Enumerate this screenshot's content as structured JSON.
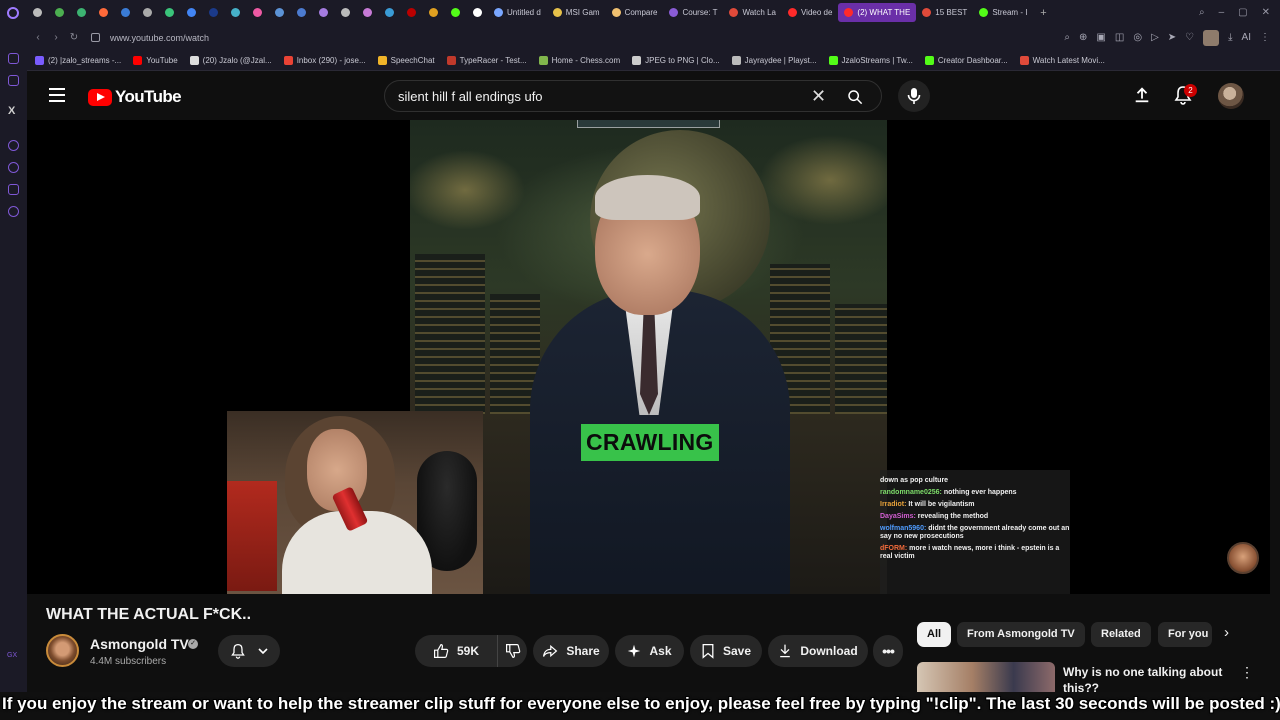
{
  "browser": {
    "tabs": [
      {
        "label": "Untitled d",
        "color": "#7aa7ff"
      },
      {
        "label": "MSI Gam",
        "color": "#e6c14a"
      },
      {
        "label": "Compare",
        "color": "#f0c070"
      },
      {
        "label": "Course: T",
        "color": "#8a5cd6"
      },
      {
        "label": "Watch La",
        "color": "#e04a3a"
      },
      {
        "label": "Video de",
        "color": "#ff2a2a"
      },
      {
        "label": "(2) WHAT THE",
        "color": "#ff2a2a",
        "active": true
      },
      {
        "label": "15 BEST",
        "color": "#e04a3a"
      },
      {
        "label": "Stream - I",
        "color": "#53fc18"
      }
    ],
    "url": "www.youtube.com/watch",
    "ai_label": "AI",
    "bookmarks": [
      {
        "label": "(2) |zalo_streams -...",
        "color": "#7a5cff"
      },
      {
        "label": "YouTube",
        "color": "#ff0000"
      },
      {
        "label": "(20) Jzalo (@Jzal...",
        "color": "#dddddd"
      },
      {
        "label": "Inbox (290) - jose...",
        "color": "#ea4335"
      },
      {
        "label": "SpeechChat",
        "color": "#f0b429"
      },
      {
        "label": "TypeRacer - Test...",
        "color": "#c0392b"
      },
      {
        "label": "Home - Chess.com",
        "color": "#81b64c"
      },
      {
        "label": "JPEG to PNG | Clo...",
        "color": "#cccccc"
      },
      {
        "label": "Jayraydee | Playst...",
        "color": "#bbbbbb"
      },
      {
        "label": "JzaloStreams | Tw...",
        "color": "#53fc18"
      },
      {
        "label": "Creator Dashboar...",
        "color": "#53fc18"
      },
      {
        "label": "Watch Latest Movi...",
        "color": "#e04a3a"
      }
    ]
  },
  "youtube": {
    "logo_text": "YouTube",
    "search_query": "silent hill f all endings ufo",
    "notification_count": "2",
    "caption_badge": "CRAWLING",
    "chat_messages": [
      {
        "user": "",
        "user_color": "#f1f1f1",
        "text": "down as pop culture"
      },
      {
        "user": "randomname0256:",
        "user_color": "#7ddc6a",
        "text": "nothing ever happens"
      },
      {
        "user": "Irradiot:",
        "user_color": "#e8a23a",
        "text": "It will be vigilantism"
      },
      {
        "user": "DayaSims:",
        "user_color": "#d35fd3",
        "text": "revealing the method"
      },
      {
        "user": "wolfman5960:",
        "user_color": "#4f9cff",
        "text": "didnt the government already come out an say no new prosecutions"
      },
      {
        "user": "dFORM:",
        "user_color": "#f06a3a",
        "text": "more i watch news, more i think - epstein is a real victim"
      }
    ],
    "video_title": "WHAT THE ACTUAL F*CK..",
    "channel_name": "Asmongold TV",
    "subscribers": "4.4M subscribers",
    "actions": {
      "like_count": "59K",
      "share": "Share",
      "ask": "Ask",
      "save": "Save",
      "download": "Download"
    },
    "chips": [
      "All",
      "From Asmongold TV",
      "Related",
      "For you"
    ],
    "recommended": {
      "title": "Why is no one talking about this??"
    }
  },
  "ticker_text": "If you enjoy the stream or want to help the streamer clip stuff for everyone else to enjoy, please feel free by typing \"!clip\". The last 30 seconds will be posted :)"
}
